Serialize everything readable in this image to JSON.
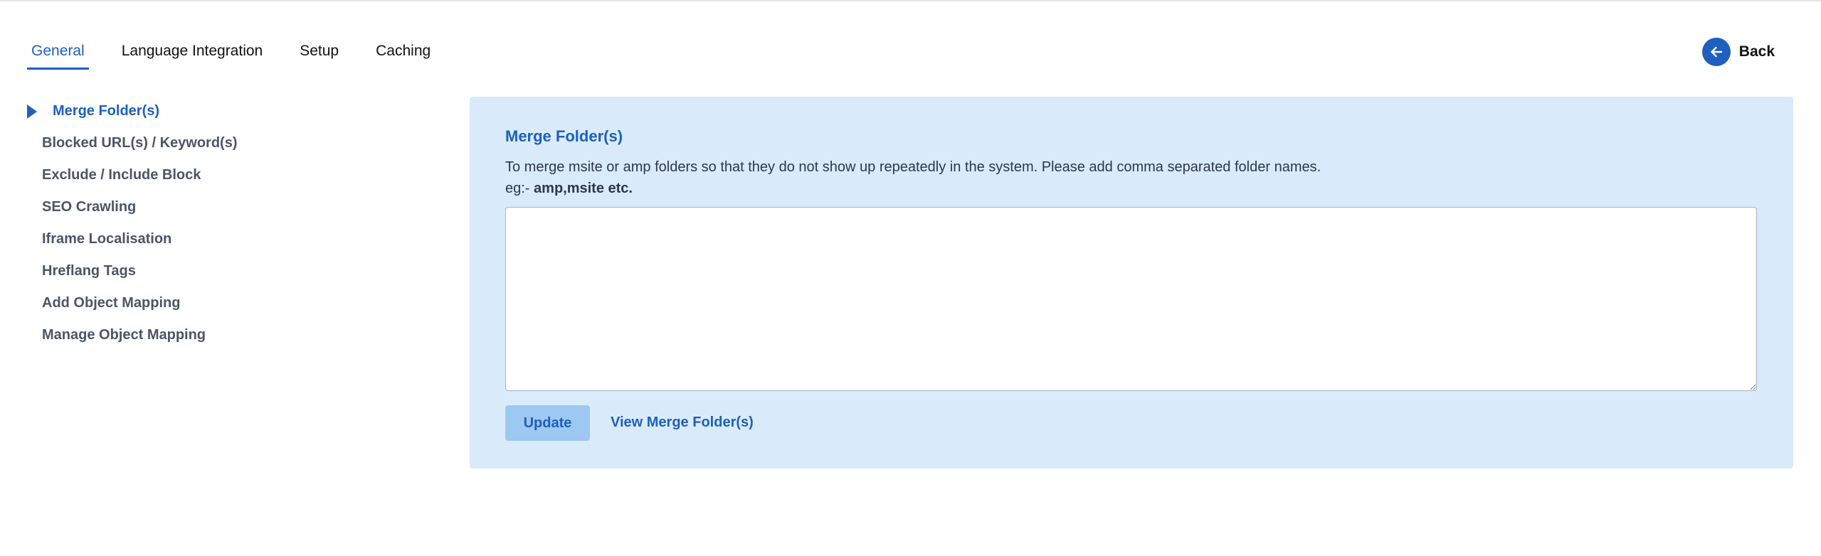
{
  "tabs": [
    {
      "label": "General",
      "active": true
    },
    {
      "label": "Language Integration",
      "active": false
    },
    {
      "label": "Setup",
      "active": false
    },
    {
      "label": "Caching",
      "active": false
    }
  ],
  "back": {
    "label": "Back",
    "icon": "arrow-left-icon"
  },
  "sidebar": {
    "items": [
      {
        "label": "Merge Folder(s)",
        "active": true
      },
      {
        "label": "Blocked URL(s) / Keyword(s)"
      },
      {
        "label": "Exclude / Include Block"
      },
      {
        "label": "SEO Crawling"
      },
      {
        "label": "Iframe Localisation"
      },
      {
        "label": "Hreflang Tags"
      },
      {
        "label": "Add Object Mapping"
      },
      {
        "label": "Manage Object Mapping"
      }
    ]
  },
  "panel": {
    "title": "Merge Folder(s)",
    "description": "To merge msite or amp folders so that they do not show up repeatedly in the system. Please add comma separated folder names.",
    "example_prefix": "eg:- ",
    "example_value": "amp,msite etc.",
    "input_value": "",
    "input_placeholder": "",
    "update_label": "Update",
    "view_link_label": "View Merge Folder(s)"
  },
  "colors": {
    "accent": "#1e5fbf",
    "panel_bg": "#d9ebfb",
    "button_bg": "#9cc8f2"
  }
}
